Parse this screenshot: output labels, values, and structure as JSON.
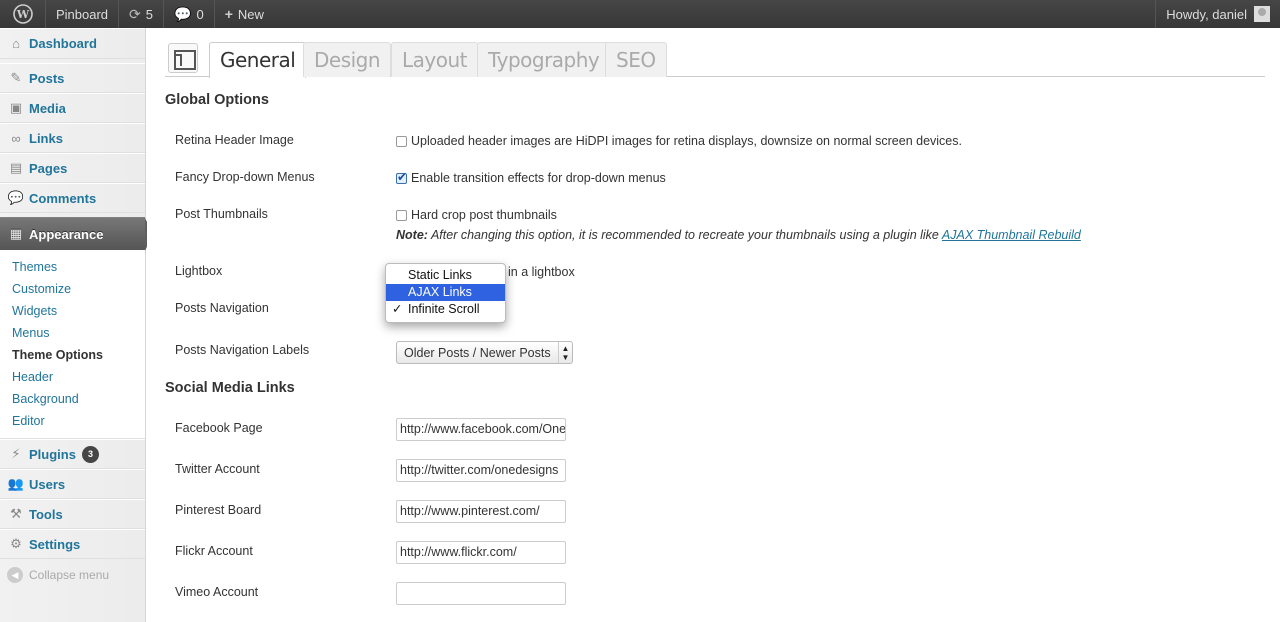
{
  "adminbar": {
    "site_name": "Pinboard",
    "updates": "5",
    "comments": "0",
    "new_label": "New",
    "howdy": "Howdy, daniel"
  },
  "sidebar": {
    "items": [
      {
        "label": "Dashboard",
        "icon": "dashboard-icon"
      },
      {
        "label": "Posts",
        "icon": "pin-icon"
      },
      {
        "label": "Media",
        "icon": "media-icon"
      },
      {
        "label": "Links",
        "icon": "link-icon"
      },
      {
        "label": "Pages",
        "icon": "pages-icon"
      },
      {
        "label": "Comments",
        "icon": "comments-icon"
      },
      {
        "label": "Appearance",
        "icon": "appearance-icon"
      }
    ],
    "appearance_submenu": [
      "Themes",
      "Customize",
      "Widgets",
      "Menus",
      "Theme Options",
      "Header",
      "Background",
      "Editor"
    ],
    "after_items": [
      {
        "label": "Plugins",
        "icon": "plugins-icon",
        "count": "3"
      },
      {
        "label": "Users",
        "icon": "users-icon"
      },
      {
        "label": "Tools",
        "icon": "tools-icon"
      },
      {
        "label": "Settings",
        "icon": "settings-icon"
      }
    ],
    "collapse_label": "Collapse menu"
  },
  "tabs": [
    "General",
    "Design",
    "Layout",
    "Typography",
    "SEO"
  ],
  "global_options": {
    "title": "Global Options",
    "retina": {
      "label": "Retina Header Image",
      "text": "Uploaded header images are HiDPI images for retina displays, downsize on normal screen devices.",
      "checked": false
    },
    "fancy": {
      "label": "Fancy Drop-down Menus",
      "text": "Enable transition effects for drop-down menus",
      "checked": true
    },
    "thumbs": {
      "label": "Post Thumbnails",
      "text": "Hard crop post thumbnails",
      "checked": false
    },
    "note_prefix": "Note:",
    "note_text": " After changing this option, it is recommended to recreate your thumbnails using a plugin like ",
    "note_link": "AJAX Thumbnail Rebuild",
    "lightbox": {
      "label": "Lightbox",
      "partial_text": "in a lightbox"
    },
    "posts_nav": {
      "label": "Posts Navigation"
    },
    "nav_labels": {
      "label": "Posts Navigation Labels",
      "value": "Older Posts / Newer Posts"
    }
  },
  "dropdown": {
    "options": [
      "Static Links",
      "AJAX Links",
      "Infinite Scroll"
    ],
    "highlighted": "AJAX Links",
    "checked": "Infinite Scroll",
    "check_glyph": "✓"
  },
  "social": {
    "title": "Social Media Links",
    "fields": [
      {
        "label": "Facebook Page",
        "value": "http://www.facebook.com/One"
      },
      {
        "label": "Twitter Account",
        "value": "http://twitter.com/onedesigns"
      },
      {
        "label": "Pinterest Board",
        "value": "http://www.pinterest.com/"
      },
      {
        "label": "Flickr Account",
        "value": "http://www.flickr.com/"
      },
      {
        "label": "Vimeo Account",
        "value": ""
      }
    ]
  }
}
